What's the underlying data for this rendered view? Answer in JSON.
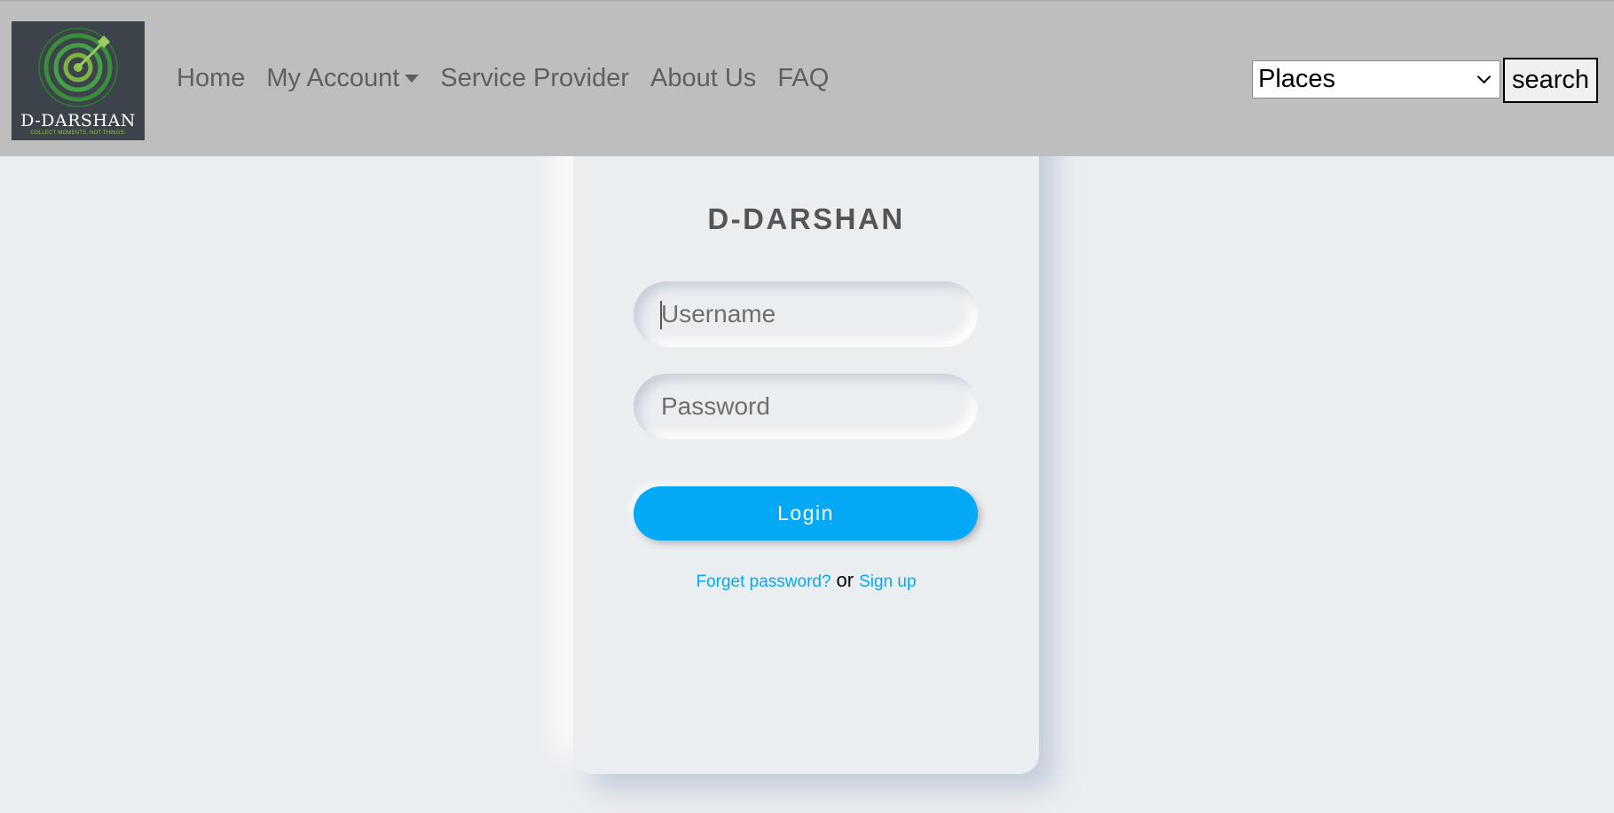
{
  "navbar": {
    "logo": {
      "name": "D-DARSHAN",
      "tagline": "COLLECT MOMENTS, NOT THINGS.",
      "icon": "target-arrow-icon"
    },
    "links": {
      "home": "Home",
      "my_account": "My Account",
      "service_provider": "Service Provider",
      "about_us": "About Us",
      "faq": "FAQ"
    },
    "places_select": {
      "value": "Places"
    },
    "search_label": "search"
  },
  "login_card": {
    "title": "D-DARSHAN",
    "username_placeholder": "Username",
    "password_placeholder": "Password",
    "login_label": "Login",
    "forgot_label": "Forget password?",
    "or_text": "or",
    "signup_label": "Sign up"
  },
  "colors": {
    "navbar_bg": "#bebebe",
    "page_bg": "#ebeef1",
    "accent": "#03a9f4",
    "logo_bg": "#3d434a",
    "logo_green": "#4caf50"
  }
}
